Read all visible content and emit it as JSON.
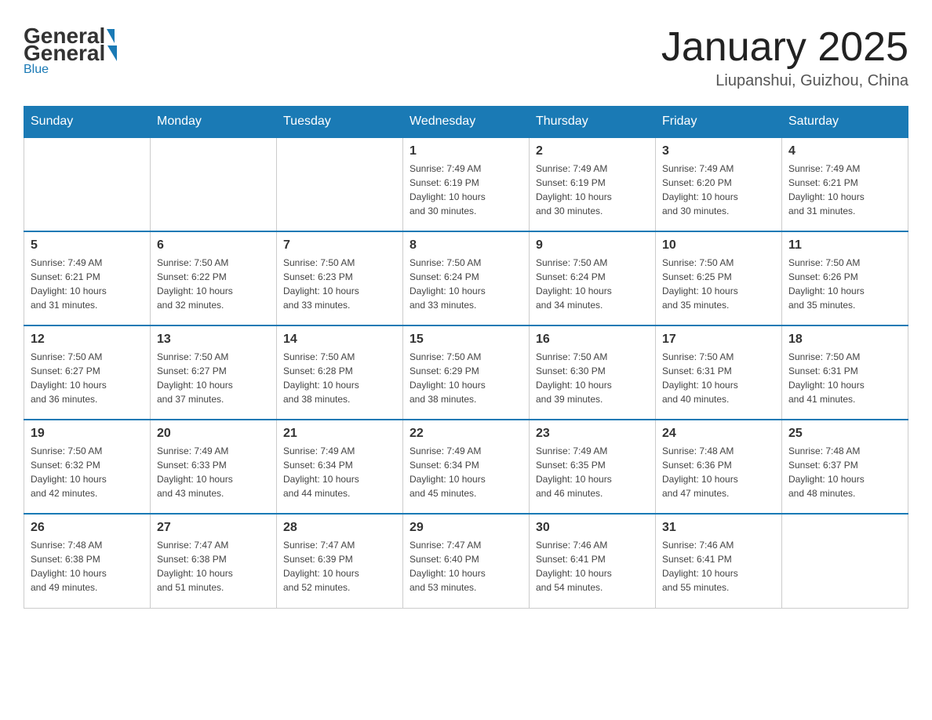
{
  "header": {
    "logo": {
      "general": "General",
      "blue": "Blue"
    },
    "title": "January 2025",
    "location": "Liupanshui, Guizhou, China"
  },
  "days_of_week": [
    "Sunday",
    "Monday",
    "Tuesday",
    "Wednesday",
    "Thursday",
    "Friday",
    "Saturday"
  ],
  "weeks": [
    [
      {
        "day": "",
        "info": ""
      },
      {
        "day": "",
        "info": ""
      },
      {
        "day": "",
        "info": ""
      },
      {
        "day": "1",
        "info": "Sunrise: 7:49 AM\nSunset: 6:19 PM\nDaylight: 10 hours\nand 30 minutes."
      },
      {
        "day": "2",
        "info": "Sunrise: 7:49 AM\nSunset: 6:19 PM\nDaylight: 10 hours\nand 30 minutes."
      },
      {
        "day": "3",
        "info": "Sunrise: 7:49 AM\nSunset: 6:20 PM\nDaylight: 10 hours\nand 30 minutes."
      },
      {
        "day": "4",
        "info": "Sunrise: 7:49 AM\nSunset: 6:21 PM\nDaylight: 10 hours\nand 31 minutes."
      }
    ],
    [
      {
        "day": "5",
        "info": "Sunrise: 7:49 AM\nSunset: 6:21 PM\nDaylight: 10 hours\nand 31 minutes."
      },
      {
        "day": "6",
        "info": "Sunrise: 7:50 AM\nSunset: 6:22 PM\nDaylight: 10 hours\nand 32 minutes."
      },
      {
        "day": "7",
        "info": "Sunrise: 7:50 AM\nSunset: 6:23 PM\nDaylight: 10 hours\nand 33 minutes."
      },
      {
        "day": "8",
        "info": "Sunrise: 7:50 AM\nSunset: 6:24 PM\nDaylight: 10 hours\nand 33 minutes."
      },
      {
        "day": "9",
        "info": "Sunrise: 7:50 AM\nSunset: 6:24 PM\nDaylight: 10 hours\nand 34 minutes."
      },
      {
        "day": "10",
        "info": "Sunrise: 7:50 AM\nSunset: 6:25 PM\nDaylight: 10 hours\nand 35 minutes."
      },
      {
        "day": "11",
        "info": "Sunrise: 7:50 AM\nSunset: 6:26 PM\nDaylight: 10 hours\nand 35 minutes."
      }
    ],
    [
      {
        "day": "12",
        "info": "Sunrise: 7:50 AM\nSunset: 6:27 PM\nDaylight: 10 hours\nand 36 minutes."
      },
      {
        "day": "13",
        "info": "Sunrise: 7:50 AM\nSunset: 6:27 PM\nDaylight: 10 hours\nand 37 minutes."
      },
      {
        "day": "14",
        "info": "Sunrise: 7:50 AM\nSunset: 6:28 PM\nDaylight: 10 hours\nand 38 minutes."
      },
      {
        "day": "15",
        "info": "Sunrise: 7:50 AM\nSunset: 6:29 PM\nDaylight: 10 hours\nand 38 minutes."
      },
      {
        "day": "16",
        "info": "Sunrise: 7:50 AM\nSunset: 6:30 PM\nDaylight: 10 hours\nand 39 minutes."
      },
      {
        "day": "17",
        "info": "Sunrise: 7:50 AM\nSunset: 6:31 PM\nDaylight: 10 hours\nand 40 minutes."
      },
      {
        "day": "18",
        "info": "Sunrise: 7:50 AM\nSunset: 6:31 PM\nDaylight: 10 hours\nand 41 minutes."
      }
    ],
    [
      {
        "day": "19",
        "info": "Sunrise: 7:50 AM\nSunset: 6:32 PM\nDaylight: 10 hours\nand 42 minutes."
      },
      {
        "day": "20",
        "info": "Sunrise: 7:49 AM\nSunset: 6:33 PM\nDaylight: 10 hours\nand 43 minutes."
      },
      {
        "day": "21",
        "info": "Sunrise: 7:49 AM\nSunset: 6:34 PM\nDaylight: 10 hours\nand 44 minutes."
      },
      {
        "day": "22",
        "info": "Sunrise: 7:49 AM\nSunset: 6:34 PM\nDaylight: 10 hours\nand 45 minutes."
      },
      {
        "day": "23",
        "info": "Sunrise: 7:49 AM\nSunset: 6:35 PM\nDaylight: 10 hours\nand 46 minutes."
      },
      {
        "day": "24",
        "info": "Sunrise: 7:48 AM\nSunset: 6:36 PM\nDaylight: 10 hours\nand 47 minutes."
      },
      {
        "day": "25",
        "info": "Sunrise: 7:48 AM\nSunset: 6:37 PM\nDaylight: 10 hours\nand 48 minutes."
      }
    ],
    [
      {
        "day": "26",
        "info": "Sunrise: 7:48 AM\nSunset: 6:38 PM\nDaylight: 10 hours\nand 49 minutes."
      },
      {
        "day": "27",
        "info": "Sunrise: 7:47 AM\nSunset: 6:38 PM\nDaylight: 10 hours\nand 51 minutes."
      },
      {
        "day": "28",
        "info": "Sunrise: 7:47 AM\nSunset: 6:39 PM\nDaylight: 10 hours\nand 52 minutes."
      },
      {
        "day": "29",
        "info": "Sunrise: 7:47 AM\nSunset: 6:40 PM\nDaylight: 10 hours\nand 53 minutes."
      },
      {
        "day": "30",
        "info": "Sunrise: 7:46 AM\nSunset: 6:41 PM\nDaylight: 10 hours\nand 54 minutes."
      },
      {
        "day": "31",
        "info": "Sunrise: 7:46 AM\nSunset: 6:41 PM\nDaylight: 10 hours\nand 55 minutes."
      },
      {
        "day": "",
        "info": ""
      }
    ]
  ]
}
